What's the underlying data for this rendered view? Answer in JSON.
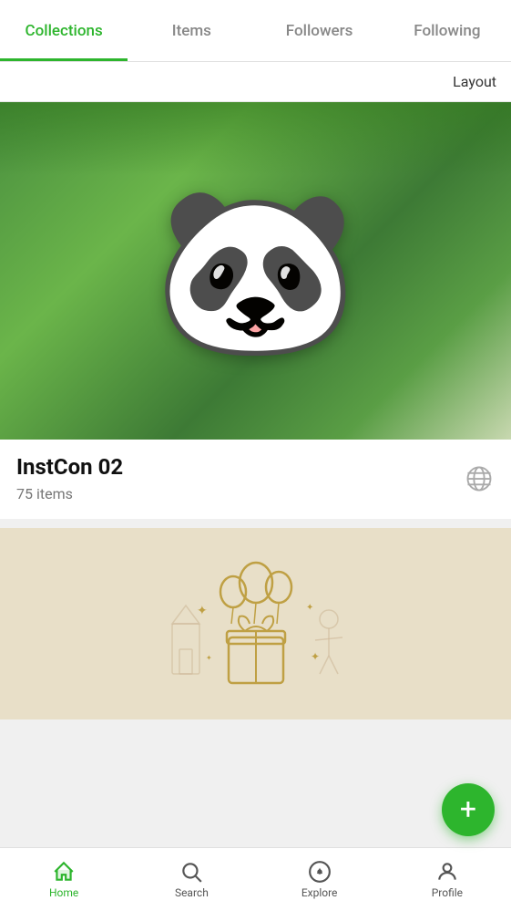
{
  "tabs": {
    "items": [
      {
        "label": "Collections",
        "active": true
      },
      {
        "label": "Items",
        "active": false
      },
      {
        "label": "Followers",
        "active": false
      },
      {
        "label": "Following",
        "active": false
      }
    ]
  },
  "layout_button": "Layout",
  "collections": [
    {
      "title": "InstCon 02",
      "subtitle": "75 items",
      "has_globe": true
    },
    {
      "title": "",
      "subtitle": ""
    }
  ],
  "fab": {
    "label": "+"
  },
  "bottom_nav": {
    "items": [
      {
        "label": "Home",
        "icon": "home-icon",
        "active": true
      },
      {
        "label": "Search",
        "icon": "search-icon",
        "active": false
      },
      {
        "label": "Explore",
        "icon": "explore-icon",
        "active": false
      },
      {
        "label": "Profile",
        "icon": "profile-icon",
        "active": false
      }
    ]
  }
}
